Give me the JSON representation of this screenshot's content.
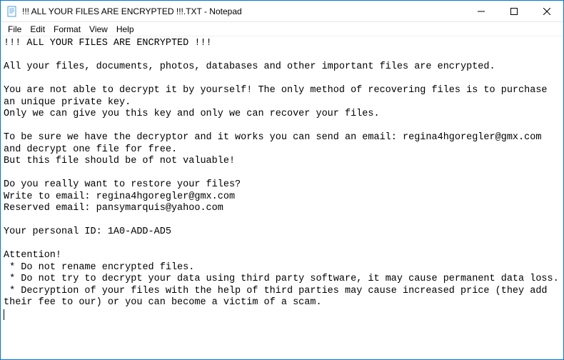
{
  "window": {
    "title": "!!! ALL YOUR FILES ARE ENCRYPTED !!!.TXT - Notepad"
  },
  "menu": {
    "file": "File",
    "edit": "Edit",
    "format": "Format",
    "view": "View",
    "help": "Help"
  },
  "document": {
    "text": "!!! ALL YOUR FILES ARE ENCRYPTED !!!\n\nAll your files, documents, photos, databases and other important files are encrypted.\n\nYou are not able to decrypt it by yourself! The only method of recovering files is to purchase an unique private key.\nOnly we can give you this key and only we can recover your files.\n\nTo be sure we have the decryptor and it works you can send an email: regina4hgoregler@gmx.com and decrypt one file for free.\nBut this file should be of not valuable!\n\nDo you really want to restore your files?\nWrite to email: regina4hgoregler@gmx.com\nReserved email: pansymarquis@yahoo.com\n\nYour personal ID: 1A0-ADD-AD5\n\nAttention!\n * Do not rename encrypted files.\n * Do not try to decrypt your data using third party software, it may cause permanent data loss.\n * Decryption of your files with the help of third parties may cause increased price (they add their fee to our) or you can become a victim of a scam."
  }
}
